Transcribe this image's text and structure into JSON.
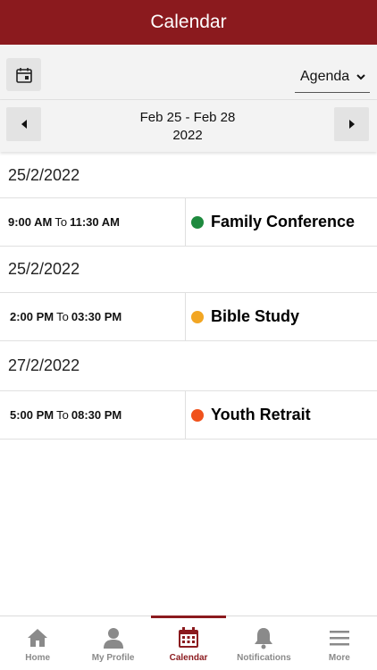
{
  "header": {
    "title": "Calendar"
  },
  "toolbar": {
    "calendar_icon": "calendar-icon",
    "view_select": "Agenda"
  },
  "navigator": {
    "range_line1": "Feb 25 - Feb 28",
    "range_line2": "2022"
  },
  "agenda": [
    {
      "date": "25/2/2022",
      "start": "9:00 AM",
      "to": "To",
      "end": "11:30 AM",
      "title": "Family Conference",
      "color": "#1e8a3e"
    },
    {
      "date": "25/2/2022",
      "start": "2:00 PM",
      "to": "To",
      "end": "03:30 PM",
      "title": "Bible Study",
      "color": "#f2a623"
    },
    {
      "date": "27/2/2022",
      "start": "5:00 PM",
      "to": "To",
      "end": "08:30 PM",
      "title": "Youth Retrait",
      "color": "#f0521c"
    }
  ],
  "tabs": [
    {
      "label": "Home",
      "icon": "home-icon"
    },
    {
      "label": "My Profile",
      "icon": "profile-icon"
    },
    {
      "label": "Calendar",
      "icon": "calendar-icon",
      "active": true
    },
    {
      "label": "Notifications",
      "icon": "bell-icon"
    },
    {
      "label": "More",
      "icon": "menu-icon"
    }
  ],
  "colors": {
    "brand": "#8b1a1e",
    "inactive": "#8a8a8a"
  }
}
